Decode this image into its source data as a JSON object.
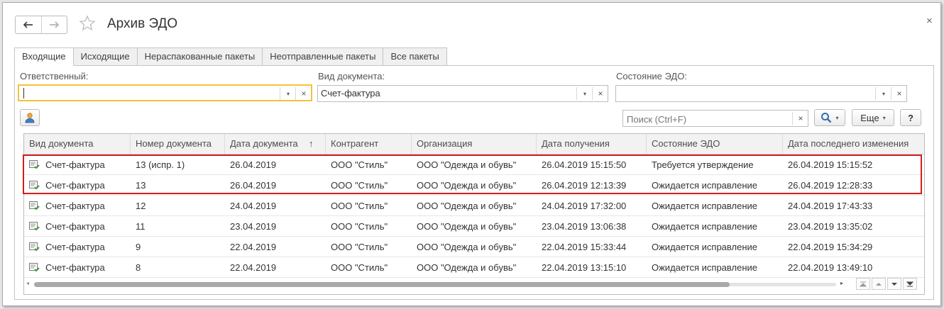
{
  "window": {
    "title": "Архив ЭДО",
    "close_glyph": "×"
  },
  "nav": {
    "back_icon": "arrow-left-icon",
    "forward_icon": "arrow-right-icon",
    "favorite_icon": "star-icon"
  },
  "tabs": [
    {
      "label": "Входящие",
      "active": true
    },
    {
      "label": "Исходящие",
      "active": false
    },
    {
      "label": "Нераспакованные пакеты",
      "active": false
    },
    {
      "label": "Неотправленные пакеты",
      "active": false
    },
    {
      "label": "Все пакеты",
      "active": false
    }
  ],
  "filters": {
    "responsible": {
      "label": "Ответственный:",
      "value": ""
    },
    "doc_type": {
      "label": "Вид документа:",
      "value": "Счет-фактура"
    },
    "edo_state": {
      "label": "Состояние ЭДО:",
      "value": ""
    }
  },
  "toolbar": {
    "search_placeholder": "Поиск (Ctrl+F)",
    "more_label": "Еще",
    "help_label": "?",
    "clear_glyph": "×",
    "dropdown_glyph": "▾"
  },
  "table": {
    "columns": [
      "Вид документа",
      "Номер документа",
      "Дата документа",
      "Контрагент",
      "Организация",
      "Дата получения",
      "Состояние ЭДО",
      "Дата последнего изменения"
    ],
    "sort_indicator": "↑",
    "rows": [
      [
        "Счет-фактура",
        "13 (испр. 1)",
        "26.04.2019",
        "ООО \"Стиль\"",
        "ООО \"Одежда и обувь\"",
        "26.04.2019 15:15:50",
        "Требуется утверждение",
        "26.04.2019 15:15:52"
      ],
      [
        "Счет-фактура",
        "13",
        "26.04.2019",
        "ООО \"Стиль\"",
        "ООО \"Одежда и обувь\"",
        "26.04.2019 12:13:39",
        "Ожидается исправление",
        "26.04.2019 12:28:33"
      ],
      [
        "Счет-фактура",
        "12",
        "24.04.2019",
        "ООО \"Стиль\"",
        "ООО \"Одежда и обувь\"",
        "24.04.2019 17:32:00",
        "Ожидается исправление",
        "24.04.2019 17:43:33"
      ],
      [
        "Счет-фактура",
        "11",
        "23.04.2019",
        "ООО \"Стиль\"",
        "ООО \"Одежда и обувь\"",
        "23.04.2019 13:06:38",
        "Ожидается исправление",
        "23.04.2019 13:35:02"
      ],
      [
        "Счет-фактура",
        "9",
        "22.04.2019",
        "ООО \"Стиль\"",
        "ООО \"Одежда и обувь\"",
        "22.04.2019 15:33:44",
        "Ожидается исправление",
        "22.04.2019 15:34:29"
      ],
      [
        "Счет-фактура",
        "8",
        "22.04.2019",
        "ООО \"Стиль\"",
        "ООО \"Одежда и обувь\"",
        "22.04.2019 13:15:10",
        "Ожидается исправление",
        "22.04.2019 13:49:10"
      ]
    ]
  },
  "colors": {
    "focus_border": "#f2c339",
    "highlight_border": "#d31f1f",
    "doc_icon_green": "#3a9a3a"
  }
}
